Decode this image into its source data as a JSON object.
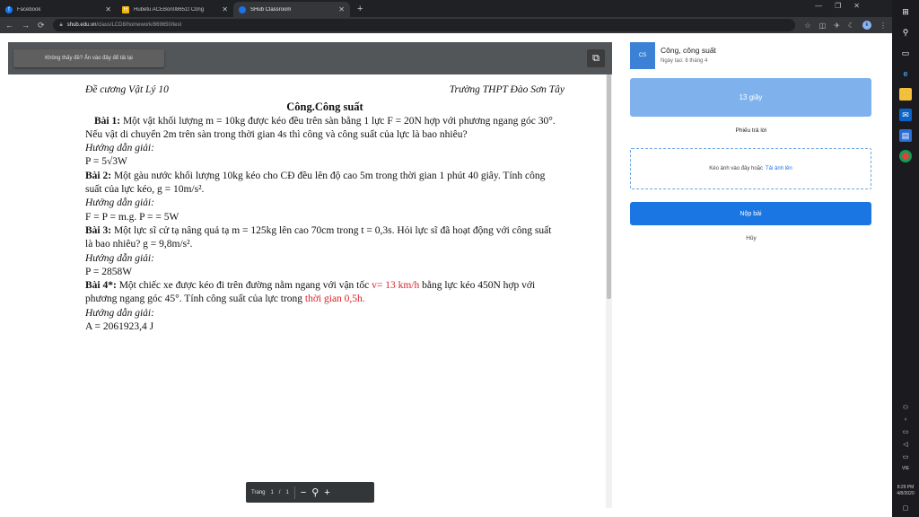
{
  "browser": {
    "tabs": [
      {
        "title": "Facebook",
        "icon": "facebook-icon",
        "color": "#1877f2",
        "active": false
      },
      {
        "title": "Hubetu ACEBon08651t Công",
        "icon": "hoc247-icon",
        "color": "#f4b400",
        "active": false
      },
      {
        "title": "SHub Classroom",
        "icon": "shub-icon",
        "color": "#1a73e8",
        "active": true
      }
    ],
    "url_host": "shub.edu.vn",
    "url_path": "/class/LCD8/homework/869650/test"
  },
  "viewer": {
    "reload_label": "Không thấy đề? Ấn vào đây để tải lại",
    "doc": {
      "left_header": "Đề cương Vật Lý 10",
      "right_header": "Trường THPT Đào Sơn Tây",
      "title": "Công.Công suất",
      "p1_label": "Bài 1:",
      "p1_text": " Một vật khối lượng m = 10kg được kéo đều trên sàn bằng 1 lực F = 20N hợp với phương ngang góc 30°. Nếu vật di chuyển 2m trên sàn trong thời gian 4s thì công và công suất của lực là bao nhiêu?",
      "hint": "Hướng dẫn giải:",
      "a1": "P = 5√3W",
      "p2_label": "Bài 2:",
      "p2_text": " Một gàu nước khối lượng 10kg kéo cho CĐ đều lên độ cao 5m trong thời gian 1 phút 40 giây. Tính công suất của lực kéo, g = 10m/s².",
      "a2": "F = P = m.g. P = = 5W",
      "p3_label": "Bài 3:",
      "p3_text": " Một lực sĩ cử tạ nâng quả tạ m = 125kg lên cao 70cm trong t = 0,3s. Hỏi lực sĩ đã hoạt động với công suất là bao nhiêu? g = 9,8m/s².",
      "a3": "P = 2858W",
      "p4_label": "Bài 4*:",
      "p4_text_a": " Một chiếc xe được kéo đi trên đường nằm ngang với vận tốc ",
      "p4_red1": "v= 13 km/h",
      "p4_text_b": " bằng lực kéo 450N hợp với phương ngang góc 45°. Tính công suất của lực trong ",
      "p4_red2": "thời gian 0,5h.",
      "a4": "A = 2061923,4 J"
    },
    "pager": {
      "label": "Trang",
      "current": "1",
      "sep": "/",
      "total": "1"
    }
  },
  "panel": {
    "avatar_text": "CS",
    "assignment_name": "Công, công suất",
    "created": "Ngày tạo: 8 tháng 4",
    "timer": "13 giây",
    "answer_sheet": "Phiếu trả lời",
    "upload_text": "Kéo ảnh vào đây hoặc",
    "upload_link": "Tải ảnh lên",
    "submit": "Nộp bài",
    "cancel": "Hủy"
  },
  "taskbar": {
    "lang": "VIE",
    "time": "8:29 PM",
    "date": "4/8/2020"
  },
  "colors": {
    "accent": "#1976e2",
    "timer": "#7fb2ec",
    "highlight_red": "#e0202a"
  }
}
